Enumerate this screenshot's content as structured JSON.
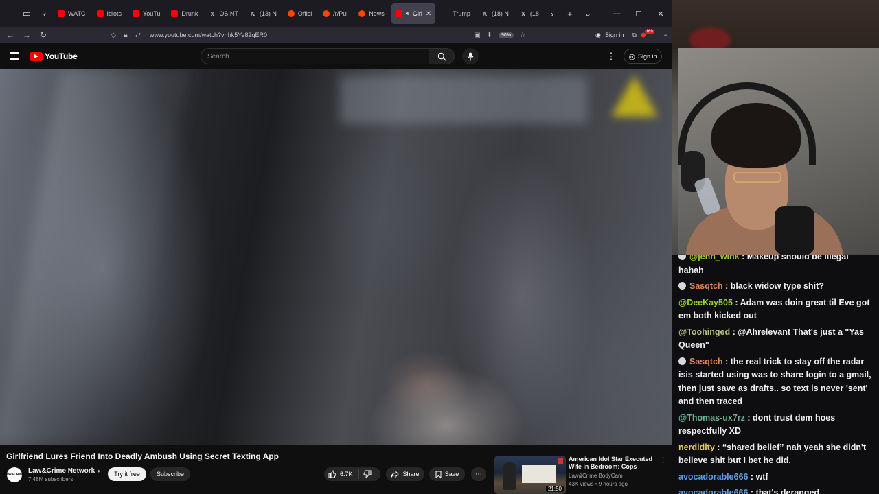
{
  "browser": {
    "tabs": [
      {
        "label": "WATC",
        "icon": "youtube-icon",
        "active": false
      },
      {
        "label": "Idiots",
        "icon": "youtube-icon",
        "active": false
      },
      {
        "label": "YouTu",
        "icon": "youtube-icon",
        "active": false
      },
      {
        "label": "Drunk",
        "icon": "youtube-icon",
        "active": false
      },
      {
        "label": "OSINT",
        "icon": "x-icon",
        "active": false
      },
      {
        "label": "(13) N",
        "icon": "x-icon",
        "active": false
      },
      {
        "label": "Offici",
        "icon": "reddit-icon",
        "active": false
      },
      {
        "label": "/r/Pul",
        "icon": "reddit-icon",
        "active": false
      },
      {
        "label": "News",
        "icon": "reddit-icon",
        "active": false
      },
      {
        "label": "Girl",
        "icon": "youtube-icon",
        "active": true
      },
      {
        "label": "Trump",
        "icon": "page-icon",
        "active": false
      },
      {
        "label": "(18) N",
        "icon": "x-icon",
        "active": false
      },
      {
        "label": "(18",
        "icon": "x-icon",
        "active": false
      }
    ],
    "url": "www.youtube.com/watch?v=hk5Ye82qER0",
    "zoom": "90%",
    "signin_label": "Sign in",
    "ext_badge": "169"
  },
  "youtube": {
    "logo_text": "YouTube",
    "search_placeholder": "Search",
    "signin_label": "Sign in",
    "video": {
      "title": "Girlfriend Lures Friend Into Deadly Ambush Using Secret Texting App",
      "channel": "Law&Crime Network",
      "channel_avatar": "LAW&CRIME",
      "subscribers": "7.48M subscribers",
      "try_label": "Try it free",
      "subscribe_label": "Subscribe",
      "likes": "6.7K",
      "share_label": "Share",
      "save_label": "Save"
    },
    "recommended": {
      "title": "American Idol Star Executed Wife in Bedroom: Cops",
      "channel": "Law&Crime BodyCam",
      "meta": "43K views • 9 hours ago",
      "duration": "21:50"
    }
  },
  "chat": {
    "messages": [
      {
        "user": "@jenn_wink",
        "text": "Makeup should be illegal hahah",
        "color": "#9acd32",
        "badge": true
      },
      {
        "user": "Sasqtch",
        "text": "black widow type shit?",
        "color": "#e0855a",
        "badge": true
      },
      {
        "user": "@DeeKay505",
        "text": "Adam was doin great til Eve got em both kicked out",
        "color": "#9acd32",
        "badge": false
      },
      {
        "user": "@Toohinged",
        "text": "@Ahrelevant That's just a \"Yas Queen\"",
        "color": "#b6c07a",
        "badge": false
      },
      {
        "user": "Sasqtch",
        "text": "the real trick to stay off the radar isis started using was to share login to a gmail, then just save as drafts.. so text is never 'sent' and then traced",
        "color": "#e0855a",
        "badge": true
      },
      {
        "user": "@Thomas-ux7rz",
        "text": "dont trust dem hoes respectfully XD",
        "color": "#6ab08e",
        "badge": false
      },
      {
        "user": "nerdidity",
        "text": "“shared belief” nah yeah she didn't believe shit but I bet he did.",
        "color": "#e6c86a",
        "badge": false
      },
      {
        "user": "avocadorable666",
        "text": "wtf",
        "color": "#5c9be0",
        "badge": false
      },
      {
        "user": "avocadorable666",
        "text": "that's deranged",
        "color": "#5c9be0",
        "badge": false
      }
    ]
  }
}
